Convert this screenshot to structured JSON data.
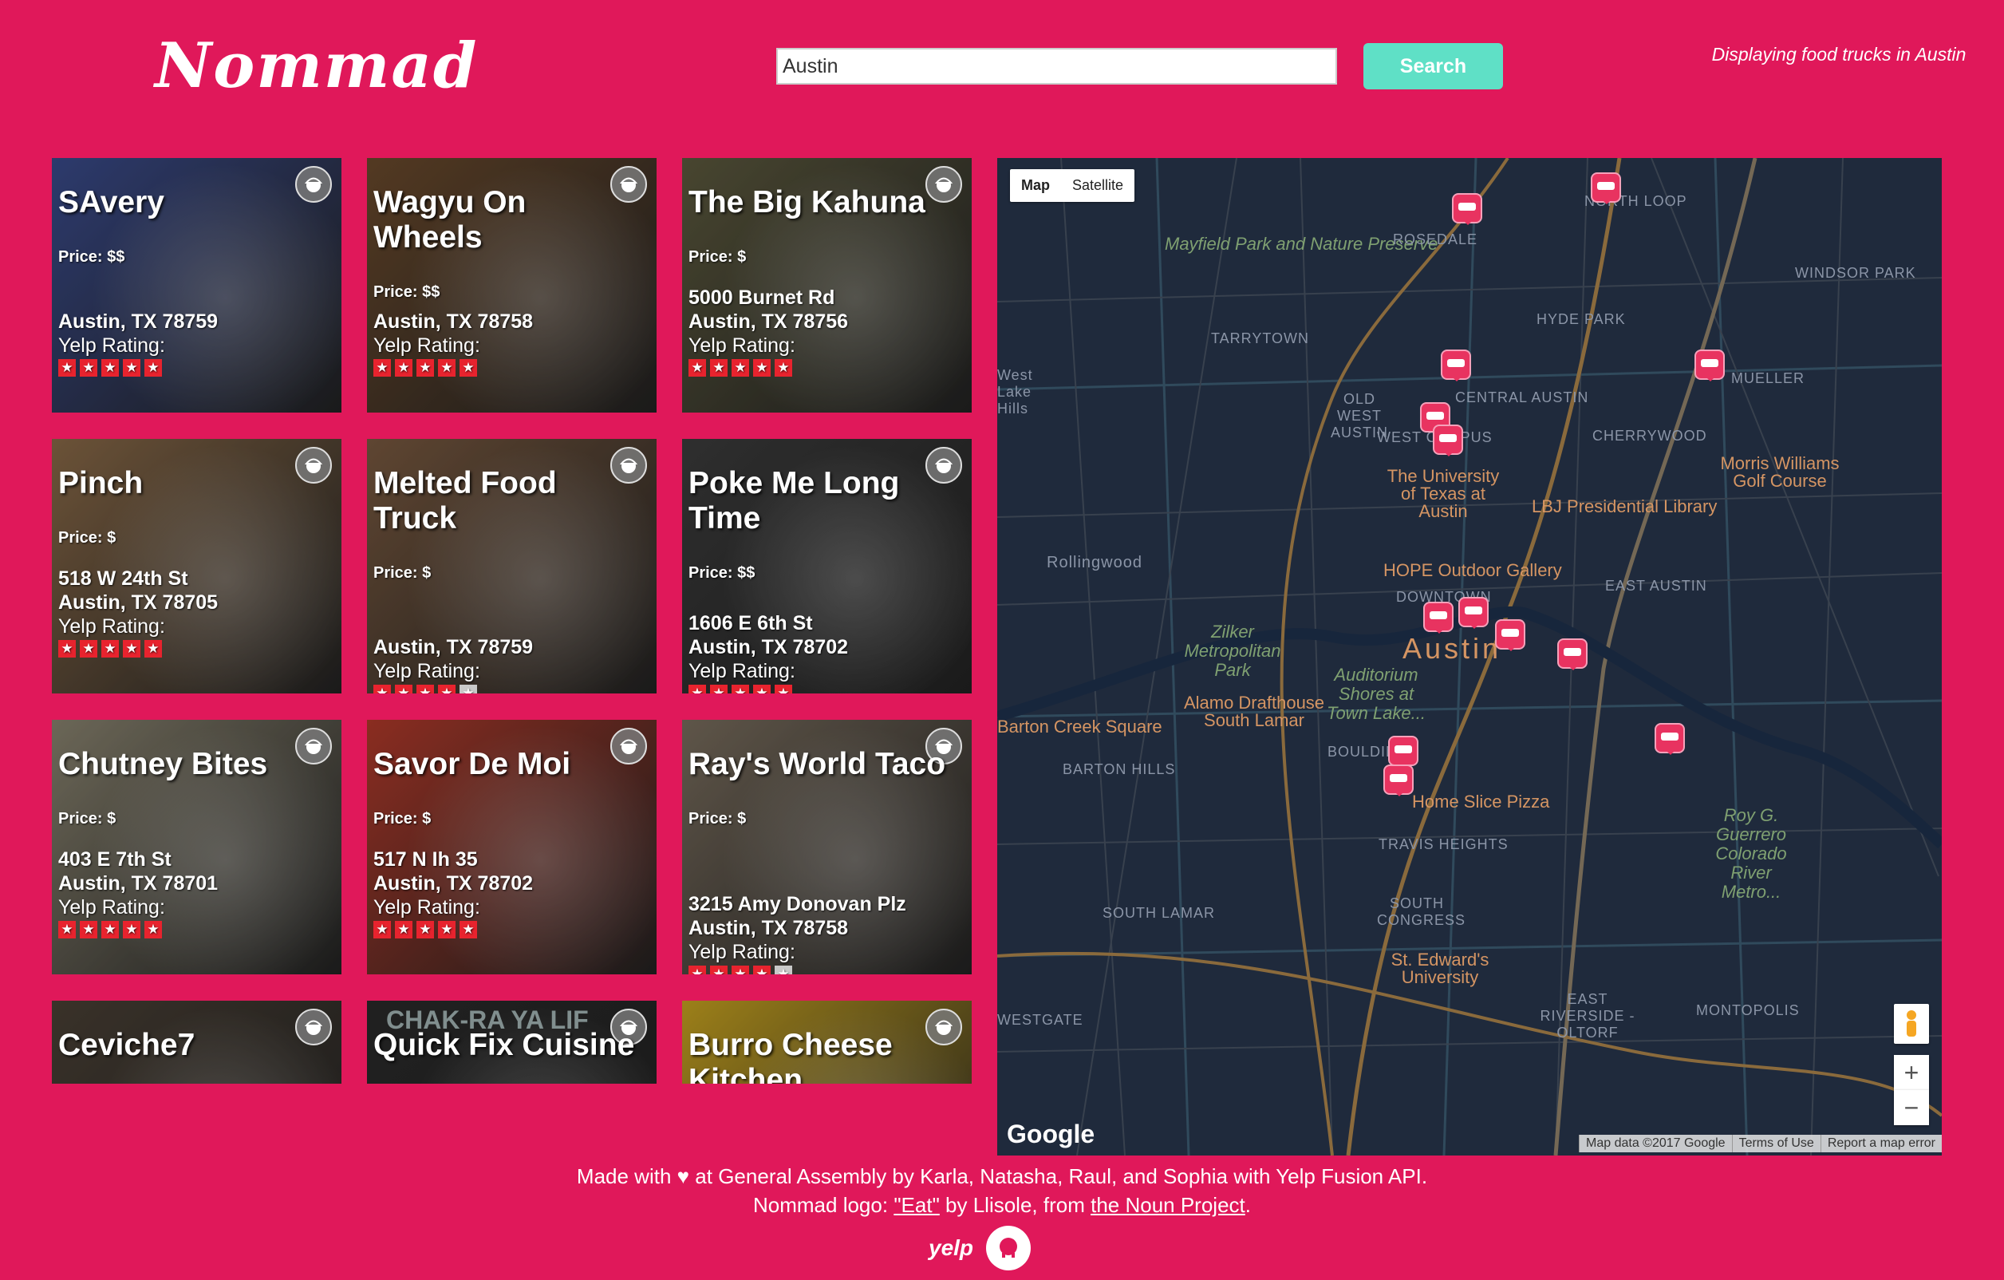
{
  "header": {
    "logo_text": "Nommad",
    "search_value": "Austin",
    "search_button": "Search",
    "display_note": "Displaying food trucks in Austin"
  },
  "cards": [
    {
      "name": "SAvery",
      "price": "Price: $$",
      "lines": [
        "Austin, TX 78759"
      ],
      "rating": 5,
      "rating_label": "Yelp Rating:",
      "bg": "#3a4b8c"
    },
    {
      "name": "Wagyu On Wheels",
      "price": "Price: $$",
      "lines": [
        "Austin, TX 78758"
      ],
      "rating": 5,
      "rating_label": "Yelp Rating:",
      "bg": "#6b4a2c"
    },
    {
      "name": "The Big Kahuna",
      "price": "Price: $",
      "lines": [
        "5000 Burnet Rd",
        "Austin, TX 78756"
      ],
      "rating": 5,
      "rating_label": "Yelp Rating:",
      "bg": "#5d5a3e"
    },
    {
      "name": "Pinch",
      "price": "Price: $",
      "lines": [
        "518 W 24th St",
        "Austin, TX 78705"
      ],
      "rating": 5,
      "rating_label": "Yelp Rating:",
      "bg": "#8a6a48"
    },
    {
      "name": "Melted Food Truck",
      "price": "Price: $",
      "lines": [
        "Austin, TX 78759"
      ],
      "rating": 4,
      "rating_label": "Yelp Rating:",
      "bg": "#7a5a40"
    },
    {
      "name": "Poke Me Long Time",
      "price": "Price: $$",
      "lines": [
        "1606 E 6th St",
        "Austin, TX 78702"
      ],
      "rating": 5,
      "rating_label": "Yelp Rating:",
      "bg": "#3c3c3c"
    },
    {
      "name": "Chutney Bites",
      "price": "Price: $",
      "lines": [
        "403 E 7th St",
        "Austin, TX 78701"
      ],
      "rating": 5,
      "rating_label": "Yelp Rating:",
      "bg": "#8a8470"
    },
    {
      "name": "Savor De Moi",
      "price": "Price: $",
      "lines": [
        "517 N Ih 35",
        "Austin, TX 78702"
      ],
      "rating": 5,
      "rating_label": "Yelp Rating:",
      "bg": "#b23a2a"
    },
    {
      "name": "Ray's World Taco",
      "price": "Price: $",
      "lines": [
        "3215 Amy Donovan Plz",
        "Austin, TX 78758"
      ],
      "rating": 4,
      "rating_label": "Yelp Rating:",
      "bg": "#7a6e5e"
    },
    {
      "name": "Ceviche7",
      "price": "",
      "lines": [],
      "rating": 0,
      "rating_label": "",
      "bg": "#4a4035"
    },
    {
      "name": "Quick Fix Cuisine",
      "price": "",
      "lines": [],
      "rating": 0,
      "rating_label": "",
      "bg": "#2a2a2a",
      "sign": "CHAK-RA YA LIF"
    },
    {
      "name": "Burro Cheese Kitchen",
      "price": "",
      "lines": [],
      "rating": 0,
      "rating_label": "",
      "bg": "#c9a420"
    }
  ],
  "map": {
    "type_map": "Map",
    "type_satellite": "Satellite",
    "zoom_in": "+",
    "zoom_out": "−",
    "google": "Google",
    "attribution": [
      "Map data ©2017 Google",
      "Terms of Use",
      "Report a map error"
    ],
    "city": "Austin",
    "parks": [
      "Mayfield Park and Nature Preserve",
      "Zilker Metropolitan Park",
      "Auditorium Shores at Town Lake...",
      "Roy G. Guerrero Colorado River Metro..."
    ],
    "neighborhoods": [
      "ROSEDALE",
      "NORTH LOOP",
      "WINDSOR PARK",
      "HYDE PARK",
      "TARRYTOWN",
      "MUELLER",
      "OLD WEST AUSTIN",
      "CENTRAL AUSTIN",
      "WEST CAMPUS",
      "CHERRYWOOD",
      "DOWNTOWN",
      "EAST AUSTIN",
      "BARTON HILLS",
      "BOULDIN",
      "TRAVIS HEIGHTS",
      "SOUTH LAMAR",
      "SOUTH CONGRESS",
      "WESTGATE",
      "EAST RIVERSIDE - OLTORF",
      "MONTOPOLIS",
      "West Lake Hills",
      "Rollingwood"
    ],
    "pois": [
      "The University of Texas at Austin",
      "LBJ Presidential Library",
      "HOPE Outdoor Gallery",
      "Alamo Drafthouse South Lamar",
      "Home Slice Pizza",
      "St. Edward's University",
      "Morris Williams Golf Course",
      "Barton Creek Square"
    ]
  },
  "footer": {
    "line1": "Made with ♥ at General Assembly by Karla, Natasha, Raul, and Sophia with Yelp Fusion API.",
    "line2_pre": "Nommad logo: ",
    "eat_link": "\"Eat\"",
    "line2_mid": " by Llisole, from ",
    "noun_link": "the Noun Project",
    "line2_post": ".",
    "yelp": "yelp"
  }
}
